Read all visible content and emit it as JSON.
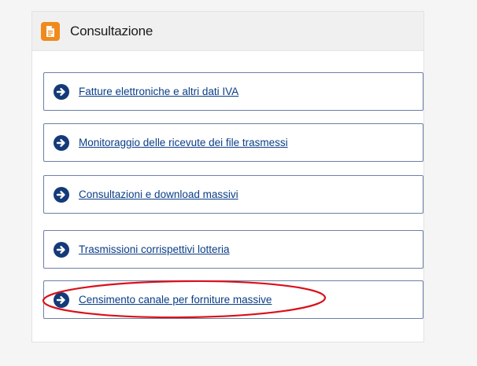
{
  "panel": {
    "title": "Consultazione",
    "icon": "document-icon",
    "icon_color": "#f08a1c"
  },
  "links": [
    {
      "label": "Fatture elettroniche e altri dati IVA",
      "icon": "arrow-right-circle-icon"
    },
    {
      "label": "Monitoraggio delle ricevute dei file trasmessi",
      "icon": "arrow-right-circle-icon"
    },
    {
      "label": "Consultazioni e download massivi",
      "icon": "arrow-right-circle-icon"
    },
    {
      "label": "Trasmissioni corrispettivi lotteria",
      "icon": "arrow-right-circle-icon"
    },
    {
      "label": "Censimento canale per forniture massive",
      "icon": "arrow-right-circle-icon"
    }
  ],
  "colors": {
    "link": "#0a3d87",
    "arrow": "#143a78",
    "box_border": "#6b7fa6",
    "highlight": "#d9101a"
  }
}
